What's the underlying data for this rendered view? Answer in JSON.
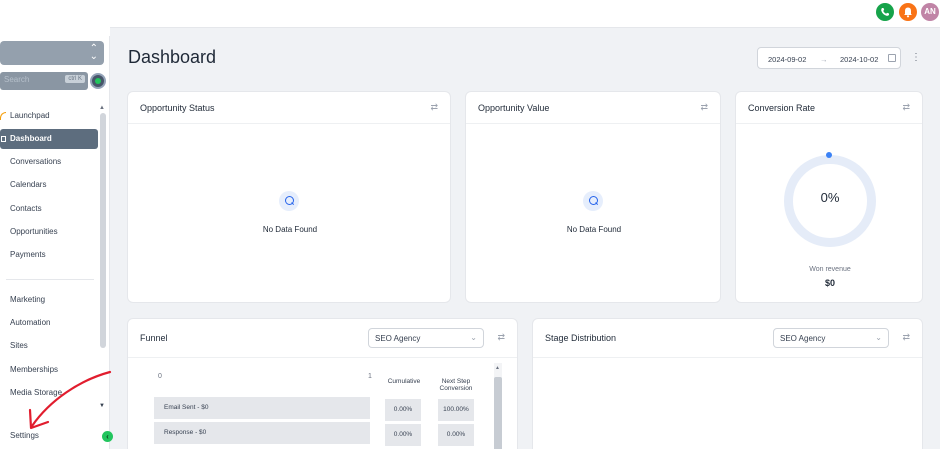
{
  "sidebar": {
    "search_placeholder": "Search",
    "search_shortcut": "ctrl K",
    "items": [
      {
        "label": "Launchpad",
        "active": false
      },
      {
        "label": "Dashboard",
        "active": true
      },
      {
        "label": "Conversations",
        "active": false
      },
      {
        "label": "Calendars",
        "active": false
      },
      {
        "label": "Contacts",
        "active": false
      },
      {
        "label": "Opportunities",
        "active": false
      },
      {
        "label": "Payments",
        "active": false
      },
      {
        "label": "Marketing",
        "active": false
      },
      {
        "label": "Automation",
        "active": false
      },
      {
        "label": "Sites",
        "active": false
      },
      {
        "label": "Memberships",
        "active": false
      },
      {
        "label": "Media Storage",
        "active": false
      }
    ],
    "settings_label": "Settings"
  },
  "topbar": {
    "phone_icon": "phone-icon",
    "notification_icon": "bell-icon",
    "avatar_initials": "AN",
    "colors": {
      "phone": "#16a34a",
      "bell": "#f97316",
      "avatar": "#c084a6"
    }
  },
  "header": {
    "title": "Dashboard",
    "date_start": "2024-09-02",
    "date_arrow": "→",
    "date_end": "2024-10-02",
    "more_icon": "⋮"
  },
  "cards": {
    "opportunity_status": {
      "title": "Opportunity Status",
      "empty_text": "No Data Found"
    },
    "opportunity_value": {
      "title": "Opportunity Value",
      "empty_text": "No Data Found"
    },
    "conversion_rate": {
      "title": "Conversion Rate",
      "value": "0%",
      "won_label": "Won revenue",
      "won_value": "$0"
    },
    "funnel": {
      "title": "Funnel",
      "pipeline": "SEO Agency",
      "axis_start": "0",
      "axis_end": "1",
      "col_cumulative": "Cumulative",
      "col_next_step": "Next Step Conversion",
      "rows": [
        {
          "label": "Email Sent  - $0",
          "cumulative": "0.00%",
          "next": "100.00%"
        },
        {
          "label": "Response - $0",
          "cumulative": "0.00%",
          "next": "0.00%"
        }
      ]
    },
    "stage_distribution": {
      "title": "Stage Distribution",
      "pipeline": "SEO Agency"
    }
  },
  "accent_color": "#2563eb"
}
